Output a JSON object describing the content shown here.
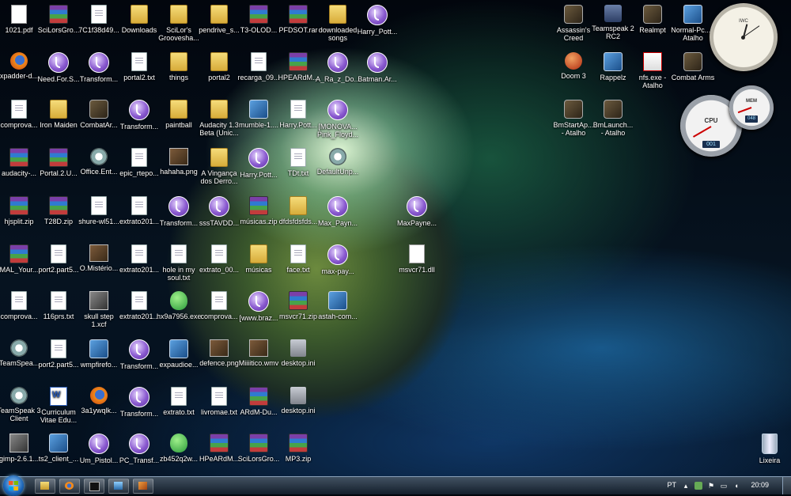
{
  "icons": [
    {
      "label": "1021.pdf",
      "type": "t-pdf",
      "glyph": "pdf-icon"
    },
    {
      "label": "SciLorsGro...",
      "type": "t-rar",
      "glyph": "rar-archive-icon"
    },
    {
      "label": "7C1f38d49...",
      "type": "t-doc",
      "glyph": "file-icon"
    },
    {
      "label": "Downloads",
      "type": "t-folder",
      "glyph": "folder-icon"
    },
    {
      "label": "SciLor's Groovesha...",
      "type": "t-folder",
      "glyph": "folder-icon",
      "wrap": true
    },
    {
      "label": "pendrive_s...",
      "type": "t-folder",
      "glyph": "folder-icon"
    },
    {
      "label": "T3-OLOD...",
      "type": "t-rar",
      "glyph": "rar-archive-icon"
    },
    {
      "label": "PFDSOT.rar",
      "type": "t-rar",
      "glyph": "rar-archive-icon"
    },
    {
      "label": "downloaded songs",
      "type": "t-folder",
      "glyph": "folder-icon",
      "wrap": true
    },
    {
      "label": "Harry_Pott...",
      "type": "t-torrent",
      "glyph": "torrent-icon"
    },
    {
      "label": "xpadder-d...",
      "type": "t-firefox",
      "glyph": "firefox-html-icon"
    },
    {
      "label": "Need.For.S...",
      "type": "t-torrent",
      "glyph": "torrent-icon"
    },
    {
      "label": "Transform...",
      "type": "t-torrent",
      "glyph": "torrent-icon"
    },
    {
      "label": "portal2.txt",
      "type": "t-doc",
      "glyph": "text-file-icon"
    },
    {
      "label": "things",
      "type": "t-folder",
      "glyph": "folder-icon"
    },
    {
      "label": "portal2",
      "type": "t-folder",
      "glyph": "folder-icon"
    },
    {
      "label": "recarga_09...",
      "type": "t-doc",
      "glyph": "file-icon"
    },
    {
      "label": "HPEARdM...",
      "type": "t-rar",
      "glyph": "rar-archive-icon"
    },
    {
      "label": "A_Ra_z_Do...",
      "type": "t-torrent",
      "glyph": "torrent-icon"
    },
    {
      "label": "Batman.Ar...",
      "type": "t-torrent",
      "glyph": "torrent-icon"
    },
    {
      "label": "comprova...",
      "type": "t-doc",
      "glyph": "file-icon"
    },
    {
      "label": "Iron Maiden",
      "type": "t-folder",
      "glyph": "folder-icon"
    },
    {
      "label": "CombatAr...",
      "type": "t-game",
      "glyph": "game-icon"
    },
    {
      "label": "Transform...",
      "type": "t-torrent",
      "glyph": "torrent-icon"
    },
    {
      "label": "paintball",
      "type": "t-folder",
      "glyph": "folder-icon"
    },
    {
      "label": "Audacity 1.3 Beta (Unic...",
      "type": "t-folder",
      "glyph": "folder-icon",
      "wrap": true
    },
    {
      "label": "mumble-1....",
      "type": "t-exe",
      "glyph": "installer-icon"
    },
    {
      "label": "Harry.Pott...",
      "type": "t-doc",
      "glyph": "file-icon"
    },
    {
      "label": "[MONOVA... Pink_Floyd...",
      "type": "t-torrent",
      "glyph": "torrent-icon",
      "wrap": true
    },
    {
      "label": "audacity-...",
      "type": "t-rar",
      "glyph": "rar-archive-icon"
    },
    {
      "label": "Portal.2.U...",
      "type": "t-rar",
      "glyph": "rar-archive-icon"
    },
    {
      "label": "Office.Ent...",
      "type": "t-gear",
      "glyph": "setup-icon"
    },
    {
      "label": "epic_rtepo...",
      "type": "t-doc",
      "glyph": "file-icon"
    },
    {
      "label": "hahaha.png",
      "type": "t-img",
      "glyph": "image-icon"
    },
    {
      "label": "A Vingança dos Derro...",
      "type": "t-folder",
      "glyph": "folder-icon",
      "wrap": true
    },
    {
      "label": "Harry.Pott...",
      "type": "t-torrent",
      "glyph": "torrent-icon"
    },
    {
      "label": "TDt.txt",
      "type": "t-doc",
      "glyph": "text-file-icon"
    },
    {
      "label": "DefaultUnp...",
      "type": "t-gear",
      "glyph": "setup-icon"
    },
    {
      "label": "hjsplit.zip",
      "type": "t-rar",
      "glyph": "rar-archive-icon"
    },
    {
      "label": "T28D.zip",
      "type": "t-rar",
      "glyph": "rar-archive-icon"
    },
    {
      "label": "shure-wl51...",
      "type": "t-doc",
      "glyph": "file-icon"
    },
    {
      "label": "extrato201...",
      "type": "t-doc",
      "glyph": "text-file-icon"
    },
    {
      "label": "Transform...",
      "type": "t-torrent",
      "glyph": "torrent-icon"
    },
    {
      "label": "sssTAVDD...",
      "type": "t-torrent",
      "glyph": "torrent-icon"
    },
    {
      "label": "músicas.zip",
      "type": "t-rar",
      "glyph": "rar-archive-icon"
    },
    {
      "label": "dfdsfdsfds...",
      "type": "t-folder",
      "glyph": "folder-icon"
    },
    {
      "label": "Max_Payn...",
      "type": "t-torrent",
      "glyph": "torrent-icon"
    },
    {
      "label": "MaxPayne...",
      "type": "t-torrent",
      "glyph": "torrent-icon"
    },
    {
      "label": "MAL_Your...",
      "type": "t-rar",
      "glyph": "rar-archive-icon"
    },
    {
      "label": "port2.part5...",
      "type": "t-doc",
      "glyph": "file-icon"
    },
    {
      "label": "O.Mistério...",
      "type": "t-img",
      "glyph": "video-icon"
    },
    {
      "label": "extrato201...",
      "type": "t-doc",
      "glyph": "text-file-icon"
    },
    {
      "label": "hole in my soul.txt",
      "type": "t-doc",
      "glyph": "text-file-icon",
      "wrap": true
    },
    {
      "label": "extrato_00...",
      "type": "t-doc",
      "glyph": "text-file-icon"
    },
    {
      "label": "músicas",
      "type": "t-folder",
      "glyph": "folder-icon"
    },
    {
      "label": "face.txt",
      "type": "t-doc",
      "glyph": "text-file-icon"
    },
    {
      "label": "max-pay...",
      "type": "t-torrent",
      "glyph": "torrent-icon"
    },
    {
      "label": "msvcr71.dll",
      "type": "t-dll",
      "glyph": "dll-icon"
    },
    {
      "label": "comprova...",
      "type": "t-doc",
      "glyph": "file-icon"
    },
    {
      "label": "116prs.txt",
      "type": "t-doc",
      "glyph": "text-file-icon"
    },
    {
      "label": "skull step 1.xcf",
      "type": "t-xcf",
      "glyph": "gimp-image-icon",
      "wrap": true
    },
    {
      "label": "extrato201...",
      "type": "t-doc",
      "glyph": "text-file-icon"
    },
    {
      "label": "hx9a7956.exe",
      "type": "t-shield",
      "glyph": "shield-exe-icon"
    },
    {
      "label": "comprova...",
      "type": "t-doc",
      "glyph": "file-icon"
    },
    {
      "label": "[www.braz...",
      "type": "t-torrent",
      "glyph": "torrent-icon"
    },
    {
      "label": "msvcr71.zip",
      "type": "t-rar",
      "glyph": "rar-archive-icon"
    },
    {
      "label": "astah-com...",
      "type": "t-exe",
      "glyph": "installer-icon"
    },
    {
      "label": "TeamSpea...",
      "type": "t-gear",
      "glyph": "teamspeak-icon"
    },
    {
      "label": "port2.part5...",
      "type": "t-doc",
      "glyph": "file-icon"
    },
    {
      "label": "wmpfirefo...",
      "type": "t-exe",
      "glyph": "installer-icon"
    },
    {
      "label": "Transform...",
      "type": "t-torrent",
      "glyph": "torrent-icon"
    },
    {
      "label": "expaudioe...",
      "type": "t-exe",
      "glyph": "monitor-icon"
    },
    {
      "label": "defence.png",
      "type": "t-img",
      "glyph": "image-icon"
    },
    {
      "label": "Miiiitico.wmv",
      "type": "t-img",
      "glyph": "video-icon"
    },
    {
      "label": "desktop.ini",
      "type": "t-ini",
      "glyph": "settings-file-icon"
    },
    {
      "label": "TeamSpeak 3 Client",
      "type": "t-gear",
      "glyph": "teamspeak-icon",
      "wrap": true
    },
    {
      "label": "Curriculum Vitae Edu...",
      "type": "t-word",
      "glyph": "word-document-icon",
      "wrap": true
    },
    {
      "label": "3a1ywqlk...",
      "type": "t-firefox",
      "glyph": "firefox-html-icon"
    },
    {
      "label": "Transform...",
      "type": "t-torrent",
      "glyph": "torrent-icon"
    },
    {
      "label": "extrato.txt",
      "type": "t-doc",
      "glyph": "text-file-icon"
    },
    {
      "label": "livromae.txt",
      "type": "t-doc",
      "glyph": "text-file-icon"
    },
    {
      "label": "ARdM-Du...",
      "type": "t-rar",
      "glyph": "rar-archive-icon"
    },
    {
      "label": "desktop.ini",
      "type": "t-ini",
      "glyph": "settings-file-icon"
    },
    {
      "label": "gimp-2.6.1...",
      "type": "t-xcf",
      "glyph": "gimp-icon"
    },
    {
      "label": "ts2_client_...",
      "type": "t-exe",
      "glyph": "installer-icon"
    },
    {
      "label": "Um_Pistol...",
      "type": "t-torrent",
      "glyph": "torrent-icon"
    },
    {
      "label": "PC_Transf...",
      "type": "t-torrent",
      "glyph": "torrent-icon"
    },
    {
      "label": "zb452q2w...",
      "type": "t-shield",
      "glyph": "shield-exe-icon"
    },
    {
      "label": "HPeARdM...",
      "type": "t-rar",
      "glyph": "rar-archive-icon"
    },
    {
      "label": "SciLorsGro...",
      "type": "t-rar",
      "glyph": "rar-archive-icon"
    },
    {
      "label": "MP3.zip",
      "type": "t-rar",
      "glyph": "rar-archive-icon"
    },
    {
      "label": "Assassin's Creed",
      "type": "t-game",
      "glyph": "game-icon",
      "wrap": true
    },
    {
      "label": "Teamspeak 2 RC2",
      "type": "t-ts",
      "glyph": "teamspeak-icon",
      "wrap": true
    },
    {
      "label": "Realmpt",
      "type": "t-game",
      "glyph": "game-icon"
    },
    {
      "label": "Normal-Pc... - Atalho",
      "type": "t-exe",
      "glyph": "shortcut-icon",
      "wrap": true
    },
    {
      "label": "Doom 3",
      "type": "t-red",
      "glyph": "game-icon"
    },
    {
      "label": "Rappelz",
      "type": "t-exe",
      "glyph": "game-icon"
    },
    {
      "label": "nfs.exe - Atalho",
      "type": "t-nfs",
      "glyph": "shortcut-icon",
      "wrap": true
    },
    {
      "label": "Combat Arms",
      "type": "t-game",
      "glyph": "game-icon",
      "wrap": true
    },
    {
      "label": "BmStartAp... - Atalho",
      "type": "t-game",
      "glyph": "shortcut-icon",
      "wrap": true
    },
    {
      "label": "BmLaunch... - Atalho",
      "type": "t-game",
      "glyph": "shortcut-icon",
      "wrap": true
    },
    {
      "label": "Lixeira",
      "type": "t-trash",
      "glyph": "recycle-bin-icon"
    }
  ],
  "gadgets": {
    "clock_brand": "IWC",
    "cpu_label": "CPU",
    "cpu_value": "001",
    "mem_label": "MEM",
    "mem_value": "048"
  },
  "taskbar": {
    "language": "PT",
    "time": "20:09",
    "pinned": [
      "explorer-icon",
      "firefox-icon",
      "cmd-icon",
      "network-icon",
      "app-icon"
    ]
  }
}
